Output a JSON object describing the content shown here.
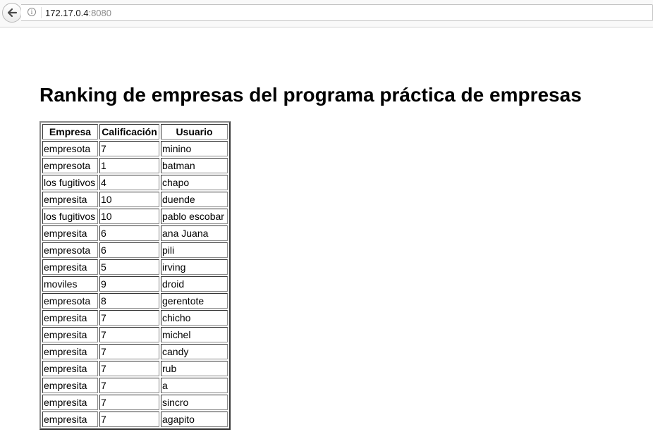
{
  "browser": {
    "url_host": "172.17.0.4",
    "url_port": ":8080"
  },
  "page": {
    "title": "Ranking de empresas del programa práctica de empresas"
  },
  "table": {
    "headers": [
      "Empresa",
      "Calificación",
      "Usuario"
    ],
    "rows": [
      [
        "empresota",
        "7",
        "minino"
      ],
      [
        "empresota",
        "1",
        "batman"
      ],
      [
        "los fugitivos",
        "4",
        "chapo"
      ],
      [
        "empresita",
        "10",
        "duende"
      ],
      [
        "los fugitivos",
        "10",
        "pablo escobar"
      ],
      [
        "empresita",
        "6",
        "ana Juana"
      ],
      [
        "empresota",
        "6",
        "pili"
      ],
      [
        "empresita",
        "5",
        "irving"
      ],
      [
        "moviles",
        "9",
        "droid"
      ],
      [
        "empresota",
        "8",
        "gerentote"
      ],
      [
        "empresita",
        "7",
        "chicho"
      ],
      [
        "empresita",
        "7",
        "michel"
      ],
      [
        "empresita",
        "7",
        "candy"
      ],
      [
        "empresita",
        "7",
        "rub"
      ],
      [
        "empresita",
        "7",
        "a"
      ],
      [
        "empresita",
        "7",
        "sincro"
      ],
      [
        "empresita",
        "7",
        "agapito"
      ]
    ]
  }
}
